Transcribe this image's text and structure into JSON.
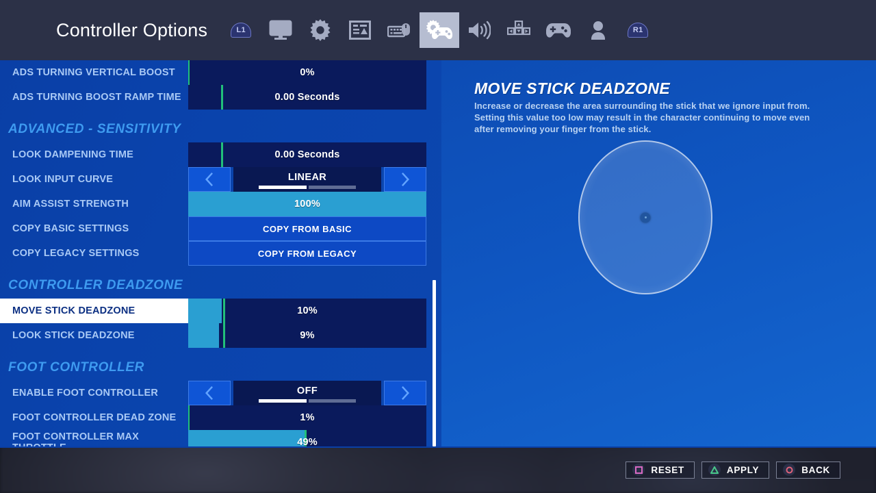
{
  "header": {
    "title": "Controller Options",
    "left_bumper": "L1",
    "right_bumper": "R1",
    "tabs": [
      {
        "icon": "monitor-icon",
        "name": "video",
        "active": false
      },
      {
        "icon": "gear-icon",
        "name": "game",
        "active": false
      },
      {
        "icon": "hud-layout-icon",
        "name": "brightness",
        "active": false
      },
      {
        "icon": "keyboard-mouse-icon",
        "name": "keyboard-mouse",
        "active": false
      },
      {
        "icon": "controller-gear-icon",
        "name": "controller-options",
        "active": true
      },
      {
        "icon": "speaker-icon",
        "name": "audio",
        "active": false
      },
      {
        "icon": "dpad-icon",
        "name": "input",
        "active": false
      },
      {
        "icon": "gamepad-icon",
        "name": "controller",
        "active": false
      },
      {
        "icon": "account-icon",
        "name": "account",
        "active": false
      }
    ]
  },
  "settings": [
    {
      "kind": "slider",
      "label": "ADS Turning Vertical Boost",
      "value": "0%",
      "fill_pct": 0,
      "tick_pct": 0,
      "selected": false,
      "highlight": false
    },
    {
      "kind": "slider",
      "label": "ADS Turning Boost Ramp Time",
      "value": "0.00 Seconds",
      "fill_pct": 0,
      "tick_pct": 14,
      "selected": false,
      "highlight": false
    },
    {
      "kind": "section",
      "label": "Advanced - Sensitivity"
    },
    {
      "kind": "slider",
      "label": "Look Dampening Time",
      "value": "0.00 Seconds",
      "fill_pct": 0,
      "tick_pct": 14,
      "selected": false,
      "highlight": false
    },
    {
      "kind": "stepper",
      "label": "Look Input Curve",
      "value": "LINEAR",
      "pages": 2,
      "page_active": 0,
      "selected": false
    },
    {
      "kind": "slider",
      "label": "Aim Assist Strength",
      "value": "100%",
      "fill_pct": 100,
      "tick_pct": -1,
      "selected": false,
      "highlight": true
    },
    {
      "kind": "button",
      "label": "Copy Basic Settings",
      "value": "COPY FROM BASIC",
      "selected": false
    },
    {
      "kind": "button",
      "label": "Copy Legacy Settings",
      "value": "COPY FROM LEGACY",
      "selected": false
    },
    {
      "kind": "section",
      "label": "Controller Deadzone"
    },
    {
      "kind": "slider",
      "label": "Move Stick Deadzone",
      "value": "10%",
      "fill_pct": 14,
      "tick_pct": 15,
      "selected": true,
      "highlight": false
    },
    {
      "kind": "slider",
      "label": "Look Stick Deadzone",
      "value": "9%",
      "fill_pct": 13,
      "tick_pct": 15,
      "selected": false,
      "highlight": false
    },
    {
      "kind": "section",
      "label": "Foot Controller"
    },
    {
      "kind": "stepper",
      "label": "Enable Foot Controller",
      "value": "OFF",
      "pages": 2,
      "page_active": 0,
      "selected": false
    },
    {
      "kind": "slider",
      "label": "Foot Controller Dead Zone",
      "value": "1%",
      "fill_pct": 0,
      "tick_pct": 0,
      "selected": false,
      "highlight": false
    },
    {
      "kind": "slider",
      "label": "Foot Controller Max Throttle",
      "value": "49%",
      "fill_pct": 49,
      "tick_pct": 49,
      "selected": false,
      "highlight": false
    }
  ],
  "detail": {
    "title": "Move Stick Deadzone",
    "description": "Increase or decrease the area surrounding the stick that we ignore input from.  Setting this value too low may result in the character continuing to move even after removing your finger from the stick.",
    "preview_icon": "deadzone-circle-preview"
  },
  "actions": [
    {
      "label": "RESET",
      "button": "square",
      "color": "#d96ac2",
      "name": "reset"
    },
    {
      "label": "APPLY",
      "button": "triangle",
      "color": "#48c88a",
      "name": "apply"
    },
    {
      "label": "BACK",
      "button": "circle",
      "color": "#e0637a",
      "name": "back"
    }
  ],
  "scroll": {
    "thumb_top_pct": 57,
    "thumb_height_pct": 43
  }
}
